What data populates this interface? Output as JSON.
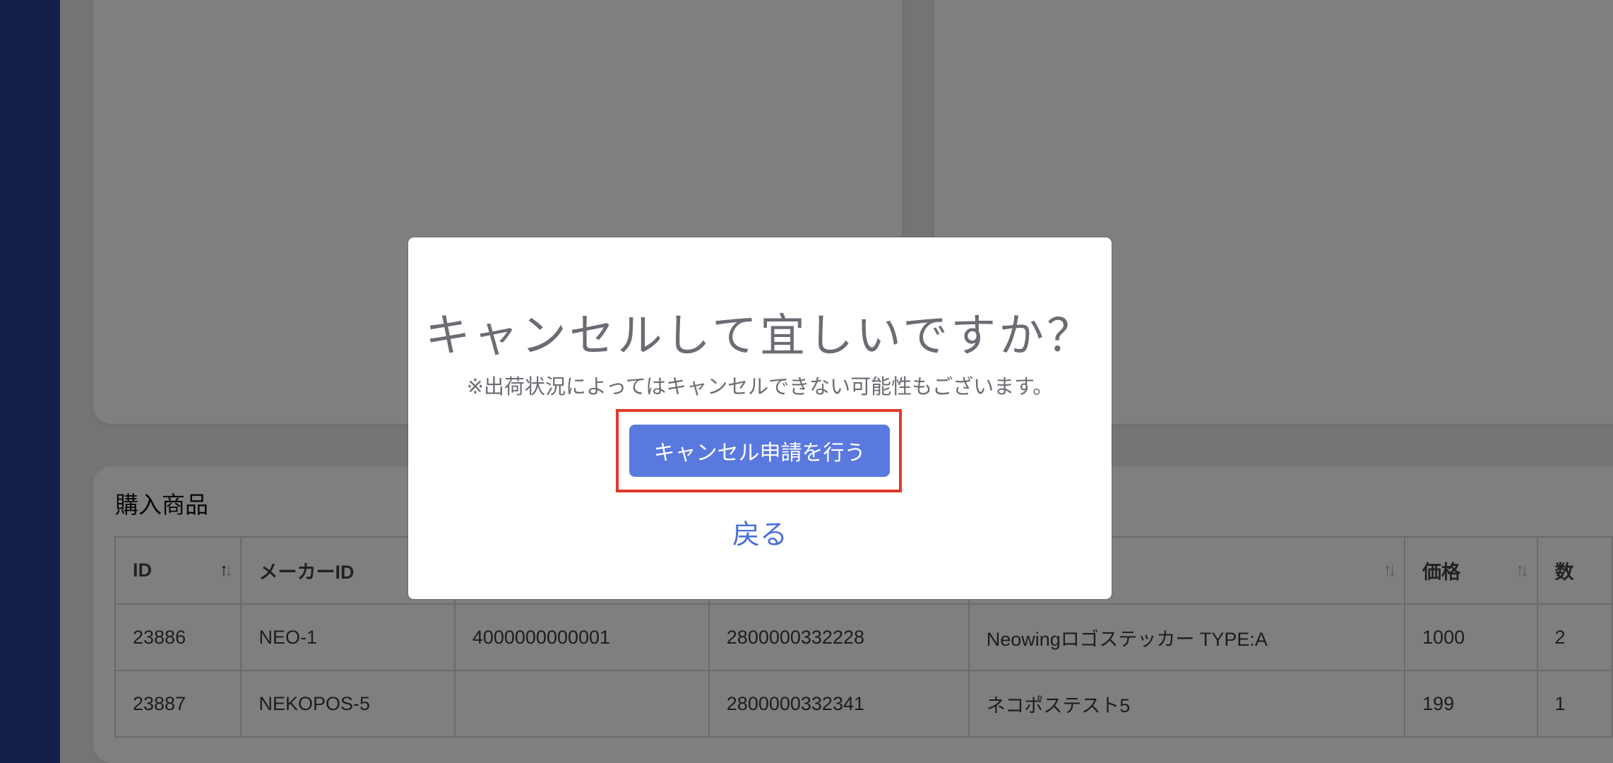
{
  "page": {
    "section_title": "購入商品"
  },
  "table": {
    "columns": [
      {
        "label": "ID",
        "sort": "↑↓"
      },
      {
        "label": "メーカーID",
        "sort": ""
      },
      {
        "label": "",
        "sort": ""
      },
      {
        "label": "",
        "sort": ""
      },
      {
        "label": "",
        "sort": "↑↓"
      },
      {
        "label": "価格",
        "sort": "↑↓"
      },
      {
        "label": "数",
        "sort": ""
      }
    ],
    "rows": [
      [
        "23886",
        "NEO-1",
        "4000000000001",
        "2800000332228",
        "Neowingロゴステッカー TYPE:A",
        "1000",
        "2"
      ],
      [
        "23887",
        "NEKOPOS-5",
        "",
        "2800000332341",
        "ネコポステスト5",
        "199",
        "1"
      ]
    ]
  },
  "modal": {
    "title": "キャンセルして宜しいですか？",
    "message": "※出荷状況によってはキャンセルできない可能性もございます。",
    "confirm_label": "キャンセル申請を行う",
    "back_label": "戻る"
  }
}
